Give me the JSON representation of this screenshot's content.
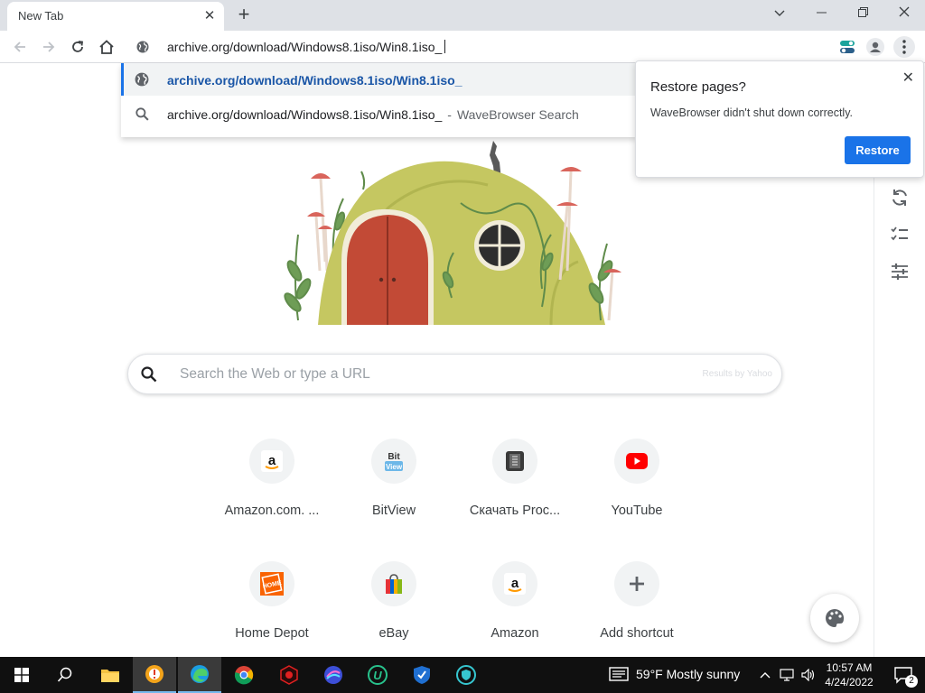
{
  "tab": {
    "title": "New Tab"
  },
  "omnibox": {
    "text": "archive.org/download/Windows8.1iso/Win8.1iso_"
  },
  "suggestions": [
    {
      "text": "archive.org/download/Windows8.1iso/Win8.1iso_",
      "icon": "globe-icon"
    },
    {
      "text": "archive.org/download/Windows8.1iso/Win8.1iso_",
      "separator": "-",
      "provider": "WaveBrowser Search",
      "icon": "search-icon"
    }
  ],
  "restore_bubble": {
    "title": "Restore pages?",
    "message": "WaveBrowser didn't shut down correctly.",
    "button": "Restore"
  },
  "search": {
    "placeholder": "Search the Web or type a URL",
    "powered_by": "Results by Yahoo"
  },
  "shortcuts": [
    {
      "label": "Amazon.com. ...",
      "icon": "amazon-icon"
    },
    {
      "label": "BitView",
      "icon": "bitview-icon"
    },
    {
      "label": "Скачать Proc...",
      "icon": "download-app-icon"
    },
    {
      "label": "YouTube",
      "icon": "youtube-icon"
    },
    {
      "label": "Home Depot",
      "icon": "homedepot-icon"
    },
    {
      "label": "eBay",
      "icon": "ebay-icon"
    },
    {
      "label": "Amazon",
      "icon": "amazon-icon"
    },
    {
      "label": "Add shortcut",
      "icon": "plus-icon"
    }
  ],
  "taskbar": {
    "weather": "59°F  Mostly sunny",
    "time": "10:57 AM",
    "date": "4/24/2022",
    "notifications": "2"
  },
  "colors": {
    "accent": "#1a73e8",
    "tabstrip": "#dee1e6",
    "taskbar": "#101010"
  }
}
